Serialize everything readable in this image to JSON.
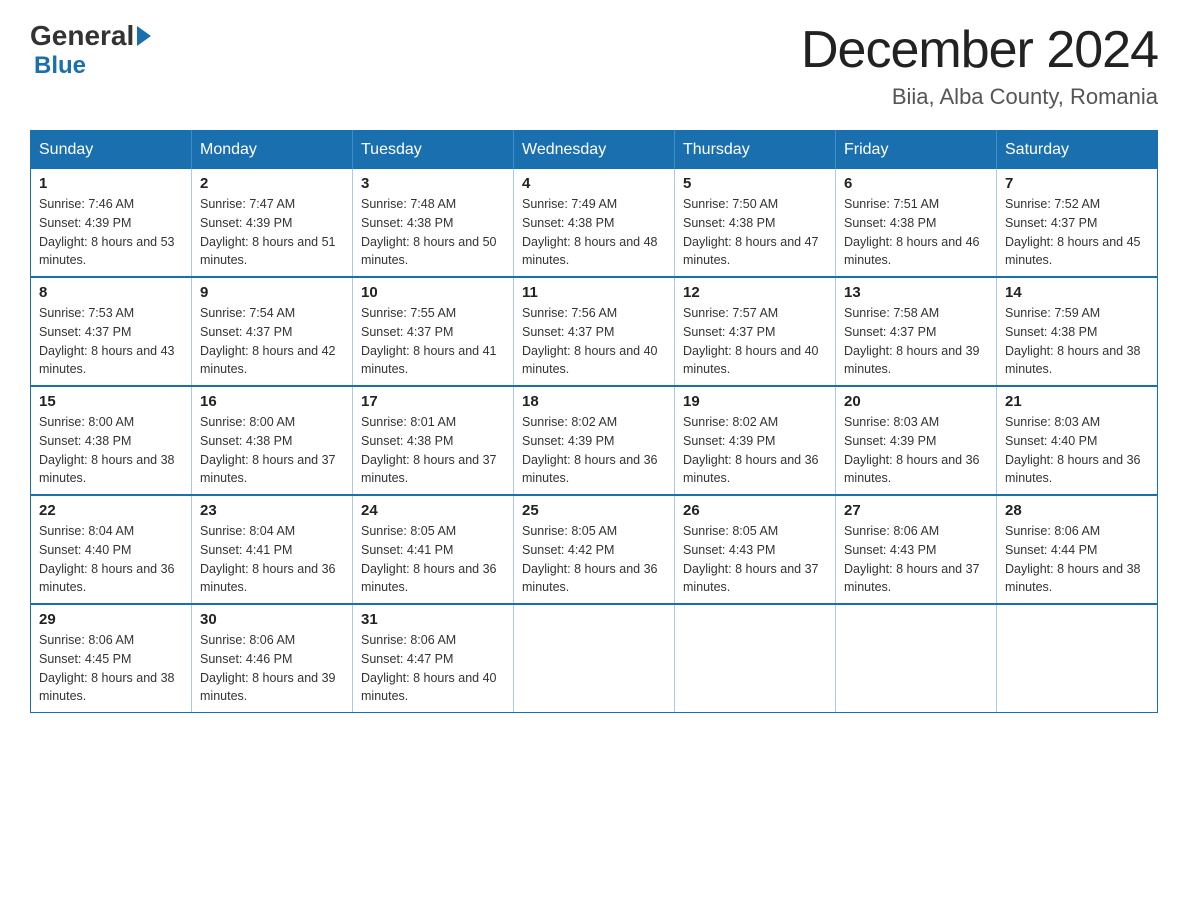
{
  "header": {
    "logo_general": "General",
    "logo_blue": "Blue",
    "main_title": "December 2024",
    "subtitle": "Biia, Alba County, Romania"
  },
  "days_of_week": [
    "Sunday",
    "Monday",
    "Tuesday",
    "Wednesday",
    "Thursday",
    "Friday",
    "Saturday"
  ],
  "weeks": [
    [
      {
        "day": "1",
        "sunrise": "7:46 AM",
        "sunset": "4:39 PM",
        "daylight": "8 hours and 53 minutes."
      },
      {
        "day": "2",
        "sunrise": "7:47 AM",
        "sunset": "4:39 PM",
        "daylight": "8 hours and 51 minutes."
      },
      {
        "day": "3",
        "sunrise": "7:48 AM",
        "sunset": "4:38 PM",
        "daylight": "8 hours and 50 minutes."
      },
      {
        "day": "4",
        "sunrise": "7:49 AM",
        "sunset": "4:38 PM",
        "daylight": "8 hours and 48 minutes."
      },
      {
        "day": "5",
        "sunrise": "7:50 AM",
        "sunset": "4:38 PM",
        "daylight": "8 hours and 47 minutes."
      },
      {
        "day": "6",
        "sunrise": "7:51 AM",
        "sunset": "4:38 PM",
        "daylight": "8 hours and 46 minutes."
      },
      {
        "day": "7",
        "sunrise": "7:52 AM",
        "sunset": "4:37 PM",
        "daylight": "8 hours and 45 minutes."
      }
    ],
    [
      {
        "day": "8",
        "sunrise": "7:53 AM",
        "sunset": "4:37 PM",
        "daylight": "8 hours and 43 minutes."
      },
      {
        "day": "9",
        "sunrise": "7:54 AM",
        "sunset": "4:37 PM",
        "daylight": "8 hours and 42 minutes."
      },
      {
        "day": "10",
        "sunrise": "7:55 AM",
        "sunset": "4:37 PM",
        "daylight": "8 hours and 41 minutes."
      },
      {
        "day": "11",
        "sunrise": "7:56 AM",
        "sunset": "4:37 PM",
        "daylight": "8 hours and 40 minutes."
      },
      {
        "day": "12",
        "sunrise": "7:57 AM",
        "sunset": "4:37 PM",
        "daylight": "8 hours and 40 minutes."
      },
      {
        "day": "13",
        "sunrise": "7:58 AM",
        "sunset": "4:37 PM",
        "daylight": "8 hours and 39 minutes."
      },
      {
        "day": "14",
        "sunrise": "7:59 AM",
        "sunset": "4:38 PM",
        "daylight": "8 hours and 38 minutes."
      }
    ],
    [
      {
        "day": "15",
        "sunrise": "8:00 AM",
        "sunset": "4:38 PM",
        "daylight": "8 hours and 38 minutes."
      },
      {
        "day": "16",
        "sunrise": "8:00 AM",
        "sunset": "4:38 PM",
        "daylight": "8 hours and 37 minutes."
      },
      {
        "day": "17",
        "sunrise": "8:01 AM",
        "sunset": "4:38 PM",
        "daylight": "8 hours and 37 minutes."
      },
      {
        "day": "18",
        "sunrise": "8:02 AM",
        "sunset": "4:39 PM",
        "daylight": "8 hours and 36 minutes."
      },
      {
        "day": "19",
        "sunrise": "8:02 AM",
        "sunset": "4:39 PM",
        "daylight": "8 hours and 36 minutes."
      },
      {
        "day": "20",
        "sunrise": "8:03 AM",
        "sunset": "4:39 PM",
        "daylight": "8 hours and 36 minutes."
      },
      {
        "day": "21",
        "sunrise": "8:03 AM",
        "sunset": "4:40 PM",
        "daylight": "8 hours and 36 minutes."
      }
    ],
    [
      {
        "day": "22",
        "sunrise": "8:04 AM",
        "sunset": "4:40 PM",
        "daylight": "8 hours and 36 minutes."
      },
      {
        "day": "23",
        "sunrise": "8:04 AM",
        "sunset": "4:41 PM",
        "daylight": "8 hours and 36 minutes."
      },
      {
        "day": "24",
        "sunrise": "8:05 AM",
        "sunset": "4:41 PM",
        "daylight": "8 hours and 36 minutes."
      },
      {
        "day": "25",
        "sunrise": "8:05 AM",
        "sunset": "4:42 PM",
        "daylight": "8 hours and 36 minutes."
      },
      {
        "day": "26",
        "sunrise": "8:05 AM",
        "sunset": "4:43 PM",
        "daylight": "8 hours and 37 minutes."
      },
      {
        "day": "27",
        "sunrise": "8:06 AM",
        "sunset": "4:43 PM",
        "daylight": "8 hours and 37 minutes."
      },
      {
        "day": "28",
        "sunrise": "8:06 AM",
        "sunset": "4:44 PM",
        "daylight": "8 hours and 38 minutes."
      }
    ],
    [
      {
        "day": "29",
        "sunrise": "8:06 AM",
        "sunset": "4:45 PM",
        "daylight": "8 hours and 38 minutes."
      },
      {
        "day": "30",
        "sunrise": "8:06 AM",
        "sunset": "4:46 PM",
        "daylight": "8 hours and 39 minutes."
      },
      {
        "day": "31",
        "sunrise": "8:06 AM",
        "sunset": "4:47 PM",
        "daylight": "8 hours and 40 minutes."
      },
      null,
      null,
      null,
      null
    ]
  ]
}
